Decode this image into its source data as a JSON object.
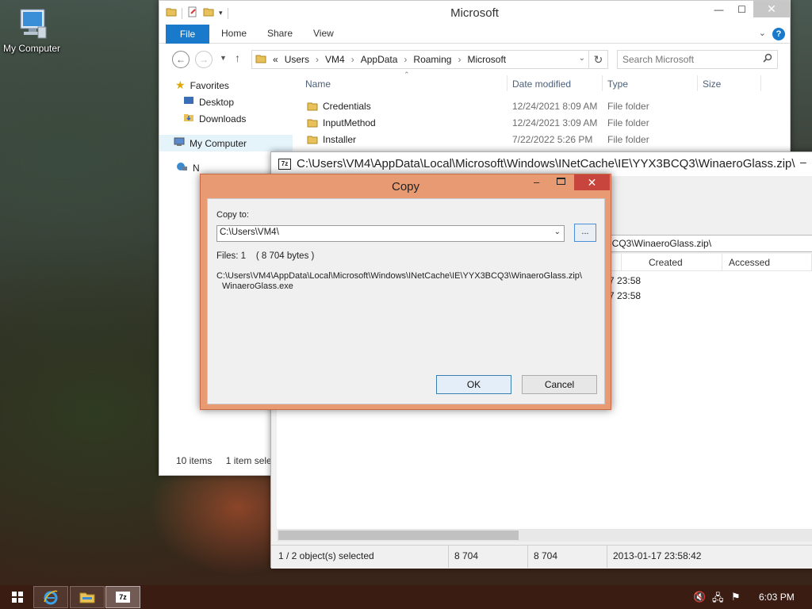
{
  "desktop": {
    "icon_label": "My Computer"
  },
  "explorer": {
    "title": "Microsoft",
    "ribbon": {
      "file": "File",
      "home": "Home",
      "share": "Share",
      "view": "View"
    },
    "address": {
      "chevron": "«",
      "parts": [
        "Users",
        "VM4",
        "AppData",
        "Roaming",
        "Microsoft"
      ],
      "separator": "›"
    },
    "search_placeholder": "Search Microsoft",
    "nav": {
      "favorites": "Favorites",
      "desktop": "Desktop",
      "downloads": "Downloads",
      "my_computer": "My Computer",
      "network_initial": "N"
    },
    "columns": {
      "name": "Name",
      "date": "Date modified",
      "type": "Type",
      "size": "Size"
    },
    "files": [
      {
        "name": "Credentials",
        "date": "12/24/2021 8:09 AM",
        "type": "File folder"
      },
      {
        "name": "InputMethod",
        "date": "12/24/2021 3:09 AM",
        "type": "File folder"
      },
      {
        "name": "Installer",
        "date": "7/22/2022 5:26 PM",
        "type": "File folder"
      }
    ],
    "status": {
      "items": "10 items",
      "selected": "1 item sele"
    }
  },
  "sevenzip": {
    "title": "C:\\Users\\VM4\\AppData\\Local\\Microsoft\\Windows\\INetCache\\IE\\YYX3BCQ3\\WinaeroGlass.zip\\",
    "logo": "7z",
    "path_visible": "3BCQ3\\WinaeroGlass.zip\\",
    "columns": {
      "created": "Created",
      "accessed": "Accessed"
    },
    "rows": [
      "7 23:58",
      "7 23:58"
    ],
    "status": {
      "selected": "1 / 2 object(s) selected",
      "size": "8 704",
      "packed": "8 704",
      "date": "2013-01-17 23:58:42"
    }
  },
  "copy_dialog": {
    "title": "Copy",
    "copy_to_label": "Copy to:",
    "destination": "C:\\Users\\VM4\\",
    "browse": "...",
    "files_info": "Files: 1    ( 8 704 bytes )",
    "source_path": "C:\\Users\\VM4\\AppData\\Local\\Microsoft\\Windows\\INetCache\\IE\\YYX3BCQ3\\WinaeroGlass.zip\\",
    "source_file": "WinaeroGlass.exe",
    "ok": "OK",
    "cancel": "Cancel"
  },
  "taskbar": {
    "clock": "6:03 PM"
  }
}
